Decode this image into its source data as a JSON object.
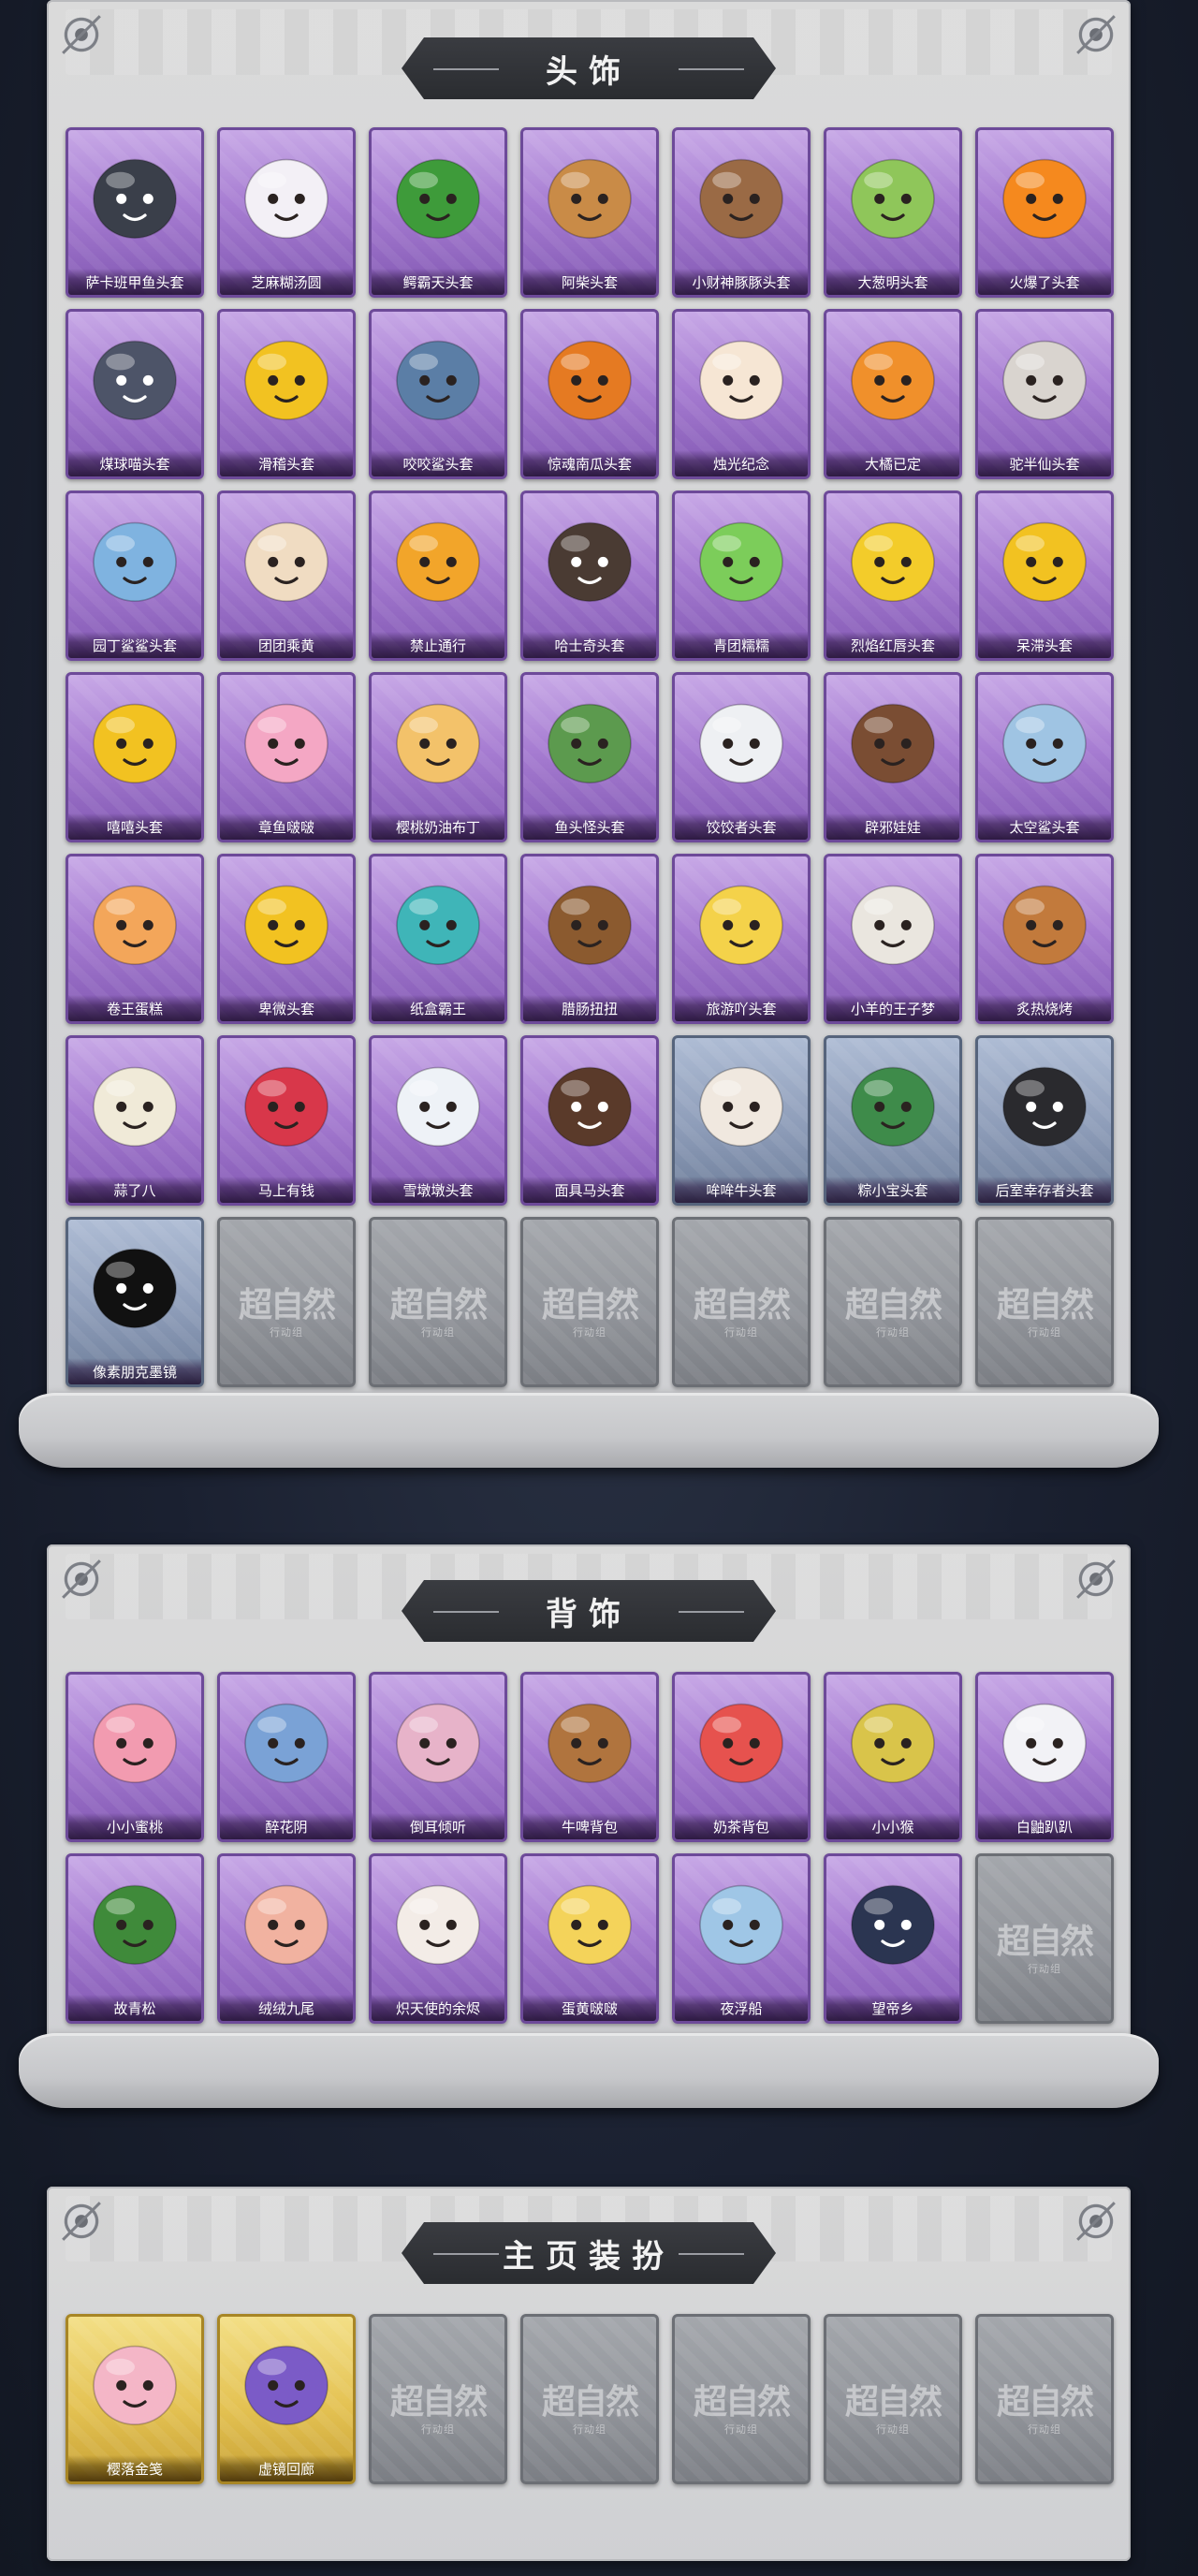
{
  "sections": [
    {
      "id": "headwear",
      "title": "头饰",
      "items": [
        {
          "label": "萨卡班甲鱼头套",
          "tier": "purple",
          "icon": "fish-head-icon",
          "color": "#3a3f4a"
        },
        {
          "label": "芝麻糊汤圆",
          "tier": "purple",
          "icon": "dumpling-icon",
          "color": "#f3f0f6"
        },
        {
          "label": "鳄霸天头套",
          "tier": "purple",
          "icon": "crocodile-icon",
          "color": "#3e9b3a"
        },
        {
          "label": "阿柴头套",
          "tier": "purple",
          "icon": "shiba-dog-icon",
          "color": "#c98b47"
        },
        {
          "label": "小财神豚豚头套",
          "tier": "purple",
          "icon": "capybara-icon",
          "color": "#9a6a45"
        },
        {
          "label": "大葱明头套",
          "tier": "purple",
          "icon": "scallion-icon",
          "color": "#8fc65a"
        },
        {
          "label": "火爆了头套",
          "tier": "purple",
          "icon": "fire-icon",
          "color": "#f5891e"
        },
        {
          "label": "煤球喵头套",
          "tier": "purple",
          "icon": "cat-icon",
          "color": "#4d5468"
        },
        {
          "label": "滑稽头套",
          "tier": "purple",
          "icon": "smirk-face-icon",
          "color": "#f2c221"
        },
        {
          "label": "咬咬鲨头套",
          "tier": "purple",
          "icon": "shark-icon",
          "color": "#5b7ea6"
        },
        {
          "label": "惊魂南瓜头套",
          "tier": "purple",
          "icon": "pumpkin-icon",
          "color": "#e57a22"
        },
        {
          "label": "烛光纪念",
          "tier": "purple",
          "icon": "candle-icon",
          "color": "#f6e6d4"
        },
        {
          "label": "大橘已定",
          "tier": "purple",
          "icon": "orange-slice-icon",
          "color": "#f0902b"
        },
        {
          "label": "驼半仙头套",
          "tier": "purple",
          "icon": "raccoon-icon",
          "color": "#d9d4cf"
        },
        {
          "label": "园丁鲨鲨头套",
          "tier": "purple",
          "icon": "gardener-shark-icon",
          "color": "#7fb3e0"
        },
        {
          "label": "团团乘黄",
          "tier": "purple",
          "icon": "hamster-icon",
          "color": "#f0dcc2"
        },
        {
          "label": "禁止通行",
          "tier": "purple",
          "icon": "traffic-cone-icon",
          "color": "#f2a52a"
        },
        {
          "label": "哈士奇头套",
          "tier": "purple",
          "icon": "husky-icon",
          "color": "#4a3b33"
        },
        {
          "label": "青团糯糯",
          "tier": "purple",
          "icon": "green-rice-ball-icon",
          "color": "#7ccd5a"
        },
        {
          "label": "烈焰红唇头套",
          "tier": "purple",
          "icon": "pikachu-icon",
          "color": "#f3cc2a"
        },
        {
          "label": "呆滞头套",
          "tier": "purple",
          "icon": "blank-face-icon",
          "color": "#f2c221"
        },
        {
          "label": "嘻嘻头套",
          "tier": "purple",
          "icon": "grin-face-icon",
          "color": "#f2c221"
        },
        {
          "label": "章鱼啵啵",
          "tier": "purple",
          "icon": "octopus-icon",
          "color": "#f4a7c4"
        },
        {
          "label": "樱桃奶油布丁",
          "tier": "purple",
          "icon": "pudding-icon",
          "color": "#f3c26a"
        },
        {
          "label": "鱼头怪头套",
          "tier": "purple",
          "icon": "fish-man-icon",
          "color": "#5c9a4e"
        },
        {
          "label": "饺饺者头套",
          "tier": "purple",
          "icon": "cloud-dumpling-icon",
          "color": "#eef0f3"
        },
        {
          "label": "辟邪娃娃",
          "tier": "purple",
          "icon": "doll-icon",
          "color": "#7a4d33"
        },
        {
          "label": "太空鲨头套",
          "tier": "purple",
          "icon": "space-shark-icon",
          "color": "#9fc4e3"
        },
        {
          "label": "卷王蛋糕",
          "tier": "purple",
          "icon": "roll-cake-icon",
          "color": "#f3a65a"
        },
        {
          "label": "卑微头套",
          "tier": "purple",
          "icon": "humble-face-icon",
          "color": "#f2c221"
        },
        {
          "label": "纸盒霸王",
          "tier": "purple",
          "icon": "box-dino-icon",
          "color": "#3fb5b8"
        },
        {
          "label": "腊肠扭扭",
          "tier": "purple",
          "icon": "dachshund-icon",
          "color": "#8b5a2f"
        },
        {
          "label": "旅游吖头套",
          "tier": "purple",
          "icon": "duck-hat-icon",
          "color": "#f4d24a"
        },
        {
          "label": "小羊的王子梦",
          "tier": "purple",
          "icon": "sheep-crown-icon",
          "color": "#eae6df"
        },
        {
          "label": "炙热烧烤",
          "tier": "purple",
          "icon": "bbq-icon",
          "color": "#c27a3c"
        },
        {
          "label": "蒜了八",
          "tier": "purple",
          "icon": "garlic-icon",
          "color": "#f0ead8"
        },
        {
          "label": "马上有钱",
          "tier": "purple",
          "icon": "red-horse-icon",
          "color": "#d8374a"
        },
        {
          "label": "雪墩墩头套",
          "tier": "purple",
          "icon": "snowman-icon",
          "color": "#eef2f7"
        },
        {
          "label": "面具马头套",
          "tier": "purple",
          "icon": "horse-mask-icon",
          "color": "#5a3a2a"
        },
        {
          "label": "哞哞牛头套",
          "tier": "blue",
          "icon": "cow-icon",
          "color": "#f0e8df"
        },
        {
          "label": "粽小宝头套",
          "tier": "blue",
          "icon": "zongzi-icon",
          "color": "#3e8b4a"
        },
        {
          "label": "后室幸存者头套",
          "tier": "blue",
          "icon": "gas-mask-icon",
          "color": "#2a2a2e"
        },
        {
          "label": "像素朋克墨镜",
          "tier": "blue",
          "icon": "pixel-sunglasses-icon",
          "color": "#111111"
        },
        {
          "label": "",
          "tier": "empty",
          "icon": "",
          "color": ""
        },
        {
          "label": "",
          "tier": "empty",
          "icon": "",
          "color": ""
        },
        {
          "label": "",
          "tier": "empty",
          "icon": "",
          "color": ""
        },
        {
          "label": "",
          "tier": "empty",
          "icon": "",
          "color": ""
        },
        {
          "label": "",
          "tier": "empty",
          "icon": "",
          "color": ""
        },
        {
          "label": "",
          "tier": "empty",
          "icon": "",
          "color": ""
        }
      ]
    },
    {
      "id": "backwear",
      "title": "背饰",
      "items": [
        {
          "label": "小小蜜桃",
          "tier": "purple",
          "icon": "peach-doll-icon",
          "color": "#f29bb0"
        },
        {
          "label": "醉花阴",
          "tier": "purple",
          "icon": "flower-wreath-icon",
          "color": "#7aa2d6"
        },
        {
          "label": "倒耳倾听",
          "tier": "purple",
          "icon": "floral-hoop-icon",
          "color": "#e7b3c9"
        },
        {
          "label": "牛啤背包",
          "tier": "purple",
          "icon": "cow-barrel-icon",
          "color": "#b0743e"
        },
        {
          "label": "奶茶背包",
          "tier": "purple",
          "icon": "milk-tea-sign-icon",
          "color": "#e6524e"
        },
        {
          "label": "小小猴",
          "tier": "purple",
          "icon": "monkey-icon",
          "color": "#d9c44a"
        },
        {
          "label": "白鼬趴趴",
          "tier": "purple",
          "icon": "ferret-icon",
          "color": "#f2f2f6"
        },
        {
          "label": "故青松",
          "tier": "purple",
          "icon": "bonsai-icon",
          "color": "#3f8a3a"
        },
        {
          "label": "绒绒九尾",
          "tier": "purple",
          "icon": "nine-tail-fox-icon",
          "color": "#f1b2a0"
        },
        {
          "label": "炽天使的余烬",
          "tier": "purple",
          "icon": "angel-doll-icon",
          "color": "#f3ece7"
        },
        {
          "label": "蛋黄啵啵",
          "tier": "purple",
          "icon": "chick-egg-icon",
          "color": "#f4d35a"
        },
        {
          "label": "夜浮船",
          "tier": "purple",
          "icon": "crystal-boat-icon",
          "color": "#9fc6e6"
        },
        {
          "label": "望帝乡",
          "tier": "purple",
          "icon": "emperor-doll-icon",
          "color": "#2b3551"
        },
        {
          "label": "",
          "tier": "empty",
          "icon": "",
          "color": ""
        }
      ]
    },
    {
      "id": "homepage",
      "title": "主页装扮",
      "items": [
        {
          "label": "樱落金笺",
          "tier": "gold",
          "icon": "sakura-card-icon",
          "color": "#f4b6c7"
        },
        {
          "label": "虚镜回廊",
          "tier": "gold",
          "icon": "mirror-card-icon",
          "color": "#7b5bc7"
        },
        {
          "label": "",
          "tier": "empty",
          "icon": "",
          "color": ""
        },
        {
          "label": "",
          "tier": "empty",
          "icon": "",
          "color": ""
        },
        {
          "label": "",
          "tier": "empty",
          "icon": "",
          "color": ""
        },
        {
          "label": "",
          "tier": "empty",
          "icon": "",
          "color": ""
        },
        {
          "label": "",
          "tier": "empty",
          "icon": "",
          "color": ""
        }
      ]
    }
  ],
  "watermark": {
    "main": "超自然",
    "sub": "行动组"
  }
}
